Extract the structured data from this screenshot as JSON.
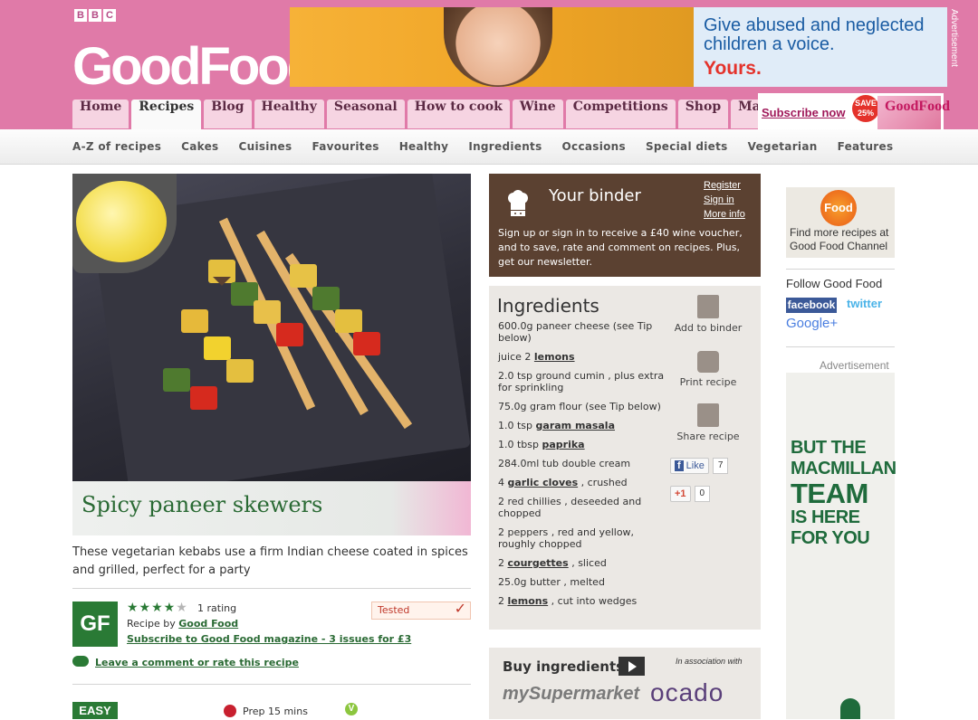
{
  "brand": {
    "bbc_letters": [
      "B",
      "B",
      "C"
    ],
    "logo": "GoodFood"
  },
  "ad_banner": {
    "headline": "Give abused and neglected children a voice.",
    "tagline": "Yours.",
    "label": "Advertisement"
  },
  "nav": {
    "tabs": [
      "Home",
      "Recipes",
      "Blog",
      "Healthy",
      "Seasonal",
      "How to cook",
      "Wine",
      "Competitions",
      "Shop",
      "Magazines & apps"
    ],
    "active_index": 1,
    "subscribe_label": "Subscribe now",
    "save_badge": "SAVE 25%",
    "magazine_name": "GoodFood"
  },
  "subnav": [
    "A-Z of recipes",
    "Cakes",
    "Cuisines",
    "Favourites",
    "Healthy",
    "Ingredients",
    "Occasions",
    "Special diets",
    "Vegetarian",
    "Features"
  ],
  "recipe": {
    "title": "Spicy paneer skewers",
    "intro": "These vegetarian kebabs use a firm Indian cheese coated in spices and grilled, perfect for a party",
    "badge": "GF",
    "rating": {
      "stars_on": "★★★★",
      "stars_off": "★",
      "text": "1 rating"
    },
    "recipe_by_prefix": "Recipe by",
    "author": "Good Food",
    "subscribe_mag": "Subscribe to Good Food magazine - 3 issues for £3",
    "tested_label": "Tested",
    "comment_link": "Leave a comment or rate this recipe",
    "difficulty": "EASY",
    "prep": "Prep 15 mins",
    "veg_icon_letter": "V"
  },
  "binder": {
    "title": "Your binder",
    "links": [
      "Register",
      "Sign in",
      "More info"
    ],
    "text": "Sign up or sign in to receive a £40 wine voucher, and to save, rate and comment on recipes. Plus, get our newsletter."
  },
  "ingredients": {
    "title": "Ingredients",
    "items": [
      {
        "pre": "600.0g paneer cheese (see Tip below)",
        "link": "",
        "post": ""
      },
      {
        "pre": "juice 2 ",
        "link": "lemons",
        "post": ""
      },
      {
        "pre": "2.0 tsp ground cumin , plus extra for sprinkling",
        "link": "",
        "post": ""
      },
      {
        "pre": "75.0g gram flour (see Tip below)",
        "link": "",
        "post": ""
      },
      {
        "pre": "1.0 tsp ",
        "link": "garam masala",
        "post": ""
      },
      {
        "pre": "1.0 tbsp ",
        "link": "paprika",
        "post": ""
      },
      {
        "pre": "284.0ml tub double cream",
        "link": "",
        "post": ""
      },
      {
        "pre": "4 ",
        "link": "garlic cloves",
        "post": " , crushed"
      },
      {
        "pre": "2 red chillies , deseeded and chopped",
        "link": "",
        "post": ""
      },
      {
        "pre": "2 peppers , red and yellow, roughly chopped",
        "link": "",
        "post": ""
      },
      {
        "pre": "2 ",
        "link": "courgettes",
        "post": " , sliced"
      },
      {
        "pre": "25.0g butter , melted",
        "link": "",
        "post": ""
      },
      {
        "pre": "2 ",
        "link": "lemons",
        "post": " , cut into wedges"
      }
    ],
    "actions": [
      "Add to binder",
      "Print recipe",
      "Share recipe"
    ],
    "fb_like": "Like",
    "fb_count": "7",
    "gplus_label": "+1",
    "gplus_count": "0"
  },
  "buy": {
    "title": "Buy ingredients",
    "assoc": "In association with",
    "retailer_1": "mySupermarket",
    "retailer_2": "ocado"
  },
  "sidebar": {
    "channel_logo": "Food",
    "channel_text": "Find more recipes at Good Food Channel",
    "follow": "Follow Good Food",
    "facebook": "facebook",
    "twitter": "twitter",
    "google": "Google+",
    "ad_label": "Advertisement",
    "mac_line1": "But the Macmillan",
    "mac_line2": "Team",
    "mac_line3": "is here for you"
  },
  "colors": {
    "header_pink": "#e07aa8",
    "green": "#2a7a35",
    "binder_brown": "#5b4131"
  }
}
